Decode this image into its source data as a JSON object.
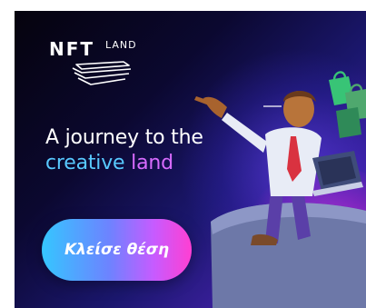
{
  "ad": {
    "logo": {
      "primary": "NFT",
      "secondary": "LAND"
    },
    "headline": {
      "line1": "A journey to the",
      "line2_word1": "creative",
      "line2_word2": "land"
    },
    "cta_label": "Κλείσε θέση"
  },
  "colors": {
    "background_dark": "#05030d",
    "background_purple": "#3a1f9c",
    "accent_cyan": "#58c9ff",
    "accent_violet": "#d86bff",
    "cta_start": "#35c6ff",
    "cta_end": "#ff3fd2"
  },
  "icons": {
    "logo_mark": "stacked-layers-icon",
    "illustration": "businessman-pointing-with-laptop"
  }
}
